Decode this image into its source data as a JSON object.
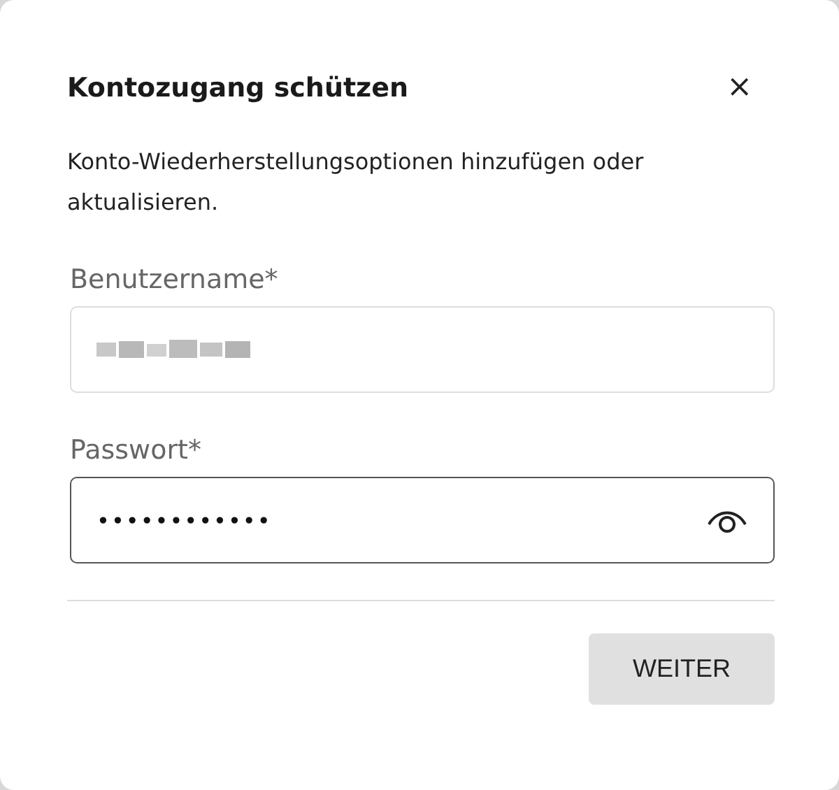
{
  "dialog": {
    "title": "Kontozugang schützen",
    "close": "×",
    "description": "Konto-Wiederherstellungsoptionen hinzufügen oder aktualisieren."
  },
  "fields": [
    {
      "kind": "text",
      "label": "Benutzername*",
      "obscured": true,
      "focused": false
    },
    {
      "kind": "password",
      "label": "Passwort*",
      "value": "••••••••••••",
      "focused": true
    }
  ],
  "buttons": [
    {
      "label": "WEITER"
    }
  ]
}
